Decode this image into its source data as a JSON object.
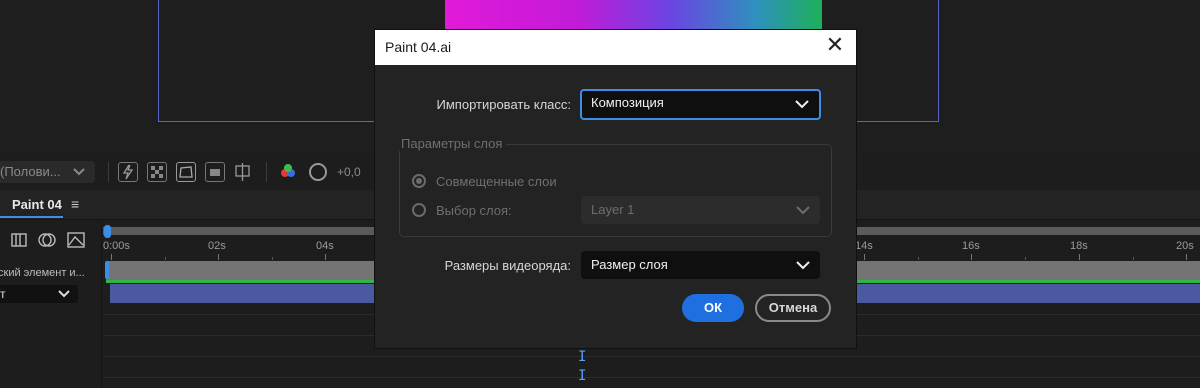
{
  "viewer": {
    "resolution_select": "(Полови...",
    "exposure_value": "+0,0"
  },
  "timeline": {
    "tab_label": "Paint 04",
    "menu_glyph": "≡",
    "ruler_labels": [
      "0:00s",
      "02s",
      "04s",
      "14s",
      "16s",
      "18s",
      "20s"
    ],
    "layer_name": "ский элемент и...",
    "mode_value": "т"
  },
  "dialog": {
    "title": "Paint 04.ai",
    "close_glyph": "✕",
    "import_kind_label": "Импортировать класс:",
    "import_kind_value": "Композиция",
    "layer_options_legend": "Параметры слоя",
    "radio_merged_label": "Совмещенные слои",
    "radio_choose_label": "Выбор слоя:",
    "layer_select_value": "Layer 1",
    "footage_size_label": "Размеры видеоряда:",
    "footage_size_value": "Размер слоя",
    "ok_label": "ОК",
    "cancel_label": "Отмена"
  },
  "colors": {
    "accent": "#3a8ee6",
    "ok_button": "#1f6fe0",
    "layer_bar_blue": "#4b5aa0",
    "layer_bar_green": "#2fb646"
  },
  "icons": [
    "chevron-down-icon",
    "close-icon",
    "menu-icon",
    "fast-previews-icon",
    "transparency-grid-icon",
    "region-of-interest-icon",
    "mask-icon",
    "guides-icon",
    "rgb-channels-icon",
    "exposure-icon",
    "render-queue-icon",
    "motion-blur-icon",
    "graph-editor-icon",
    "text-cursor-icon"
  ]
}
